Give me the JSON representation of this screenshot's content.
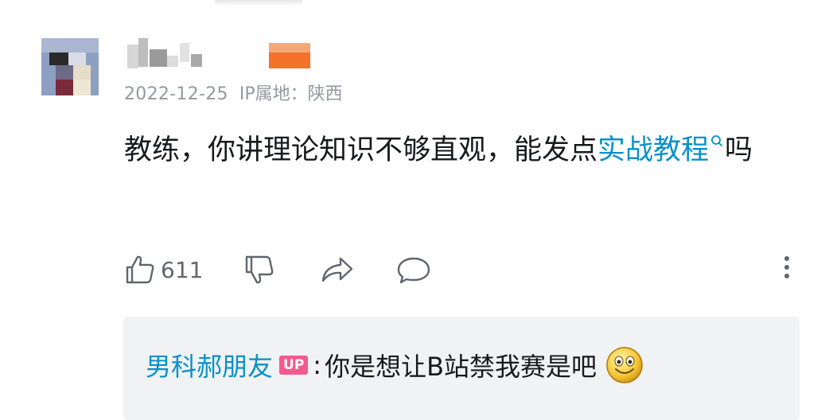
{
  "comment": {
    "date": "2022-12-25",
    "ip_location": "IP属地：陕西",
    "text_plain": "教练，你讲理论知识不够直观，能发点",
    "text_link": "实战教程",
    "text_tail": "吗",
    "search_icon": "search-icon"
  },
  "actions": {
    "like_count": "611",
    "icons": [
      "thumbs-up-icon",
      "thumbs-down-icon",
      "share-icon",
      "reply-icon",
      "more-icon"
    ]
  },
  "reply": {
    "username": "男科郝朋友",
    "badge": "UP",
    "colon": ":",
    "text": "你是想让B站禁我赛是吧",
    "emoji": "smiley-emoji"
  },
  "colors": {
    "link": "#0891c8",
    "meta": "#9499a0",
    "up_badge": "#f45a8d",
    "reply_bg": "#f1f2f3"
  }
}
